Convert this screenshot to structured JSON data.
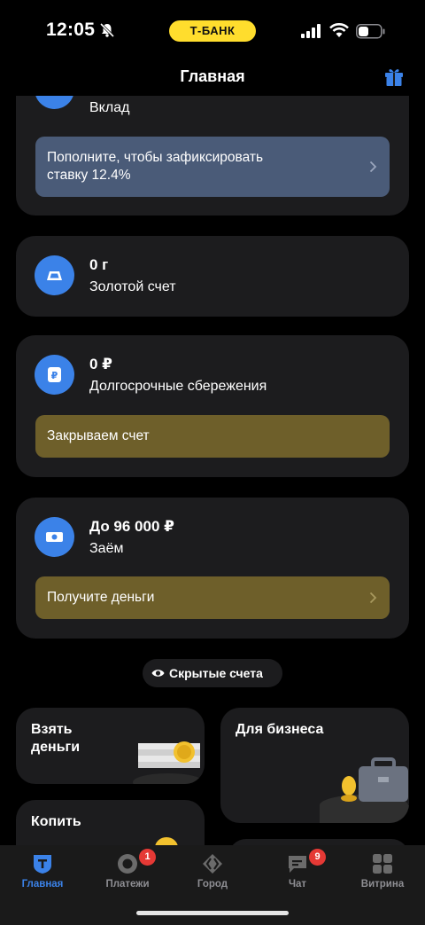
{
  "status_bar": {
    "time": "12:05",
    "carrier": "Т‑БАНК"
  },
  "header": {
    "title": "Главная"
  },
  "accounts": [
    {
      "id": "deposit",
      "amount": "",
      "name": "Вклад",
      "banner": {
        "text_line1": "Пополните, чтобы зафиксировать",
        "text_line2": "ставку 12.4%",
        "color": "#4a5b78",
        "chevron": true
      }
    },
    {
      "id": "gold",
      "amount": "0 г",
      "name": "Золотой счет"
    },
    {
      "id": "savings",
      "amount": "0 ₽",
      "name": "Долгосрочные сбережения",
      "banner": {
        "text_line1": "Закрываем счет",
        "color": "#6e5f2a",
        "chevron": false
      }
    },
    {
      "id": "loan",
      "amount": "До 96 000 ₽",
      "name": "Заём",
      "banner": {
        "text_line1": "Получите деньги",
        "color": "#6e5f2a",
        "chevron": true
      }
    }
  ],
  "hidden_accounts": {
    "label": "Скрытые счета"
  },
  "tiles": [
    {
      "id": "borrow",
      "title_line1": "Взять",
      "title_line2": "деньги"
    },
    {
      "id": "business",
      "title_line1": "Для бизнеса",
      "title_line2": ""
    },
    {
      "id": "save",
      "title_line1": "Копить",
      "title_line2": ""
    }
  ],
  "tab_bar": [
    {
      "id": "home",
      "label": "Главная",
      "active": true,
      "badge": ""
    },
    {
      "id": "payments",
      "label": "Платежи",
      "active": false,
      "badge": "1"
    },
    {
      "id": "city",
      "label": "Город",
      "active": false,
      "badge": ""
    },
    {
      "id": "chat",
      "label": "Чат",
      "active": false,
      "badge": "9"
    },
    {
      "id": "showcase",
      "label": "Витрина",
      "active": false,
      "badge": ""
    }
  ],
  "colors": {
    "accent": "#3b82e8",
    "brand_yellow": "#ffdd2d",
    "card": "#1c1c1e",
    "badge": "#e53935"
  }
}
